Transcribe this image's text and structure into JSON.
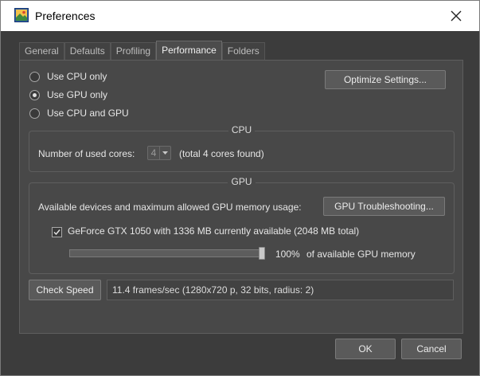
{
  "window": {
    "title": "Preferences"
  },
  "tabs": [
    {
      "label": "General",
      "active": false
    },
    {
      "label": "Defaults",
      "active": false
    },
    {
      "label": "Profiling",
      "active": false
    },
    {
      "label": "Performance",
      "active": true
    },
    {
      "label": "Folders",
      "active": false
    }
  ],
  "compute": {
    "options": [
      {
        "label": "Use CPU only",
        "selected": false
      },
      {
        "label": "Use GPU only",
        "selected": true
      },
      {
        "label": "Use CPU and GPU",
        "selected": false
      }
    ],
    "optimize_label": "Optimize Settings..."
  },
  "cpu": {
    "title": "CPU",
    "cores_label": "Number of used cores:",
    "cores_value": "4",
    "cores_found": "(total 4 cores found)"
  },
  "gpu": {
    "title": "GPU",
    "devices_label": "Available devices and maximum allowed GPU memory usage:",
    "troubleshoot_label": "GPU Troubleshooting...",
    "device_label": "GeForce GTX 1050 with 1336 MB currently available (2048 MB total)",
    "device_checked": true,
    "memory_percent": 100,
    "memory_percent_text": "100%",
    "memory_suffix": "of available GPU memory"
  },
  "speed": {
    "button_label": "Check Speed",
    "result": "11.4 frames/sec (1280x720 p, 32 bits, radius: 2)"
  },
  "footer": {
    "ok_label": "OK",
    "cancel_label": "Cancel"
  },
  "colors": {
    "panel": "#484848",
    "background": "#3c3c3c",
    "button": "#5a5a5a"
  }
}
